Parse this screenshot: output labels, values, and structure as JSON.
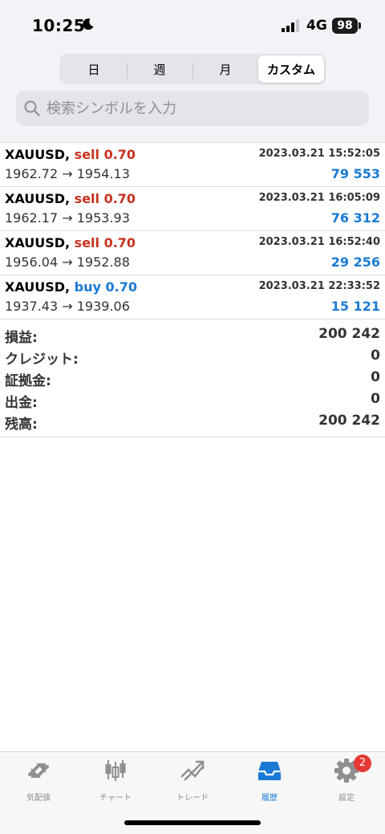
{
  "status_bar": {
    "time": "10:25",
    "network": "4G",
    "battery": "98"
  },
  "segments": [
    {
      "label": "日",
      "active": false
    },
    {
      "label": "週",
      "active": false
    },
    {
      "label": "月",
      "active": false
    },
    {
      "label": "カスタム",
      "active": true
    }
  ],
  "search": {
    "placeholder": "検索シンボルを入力"
  },
  "deals": [
    {
      "symbol": "XAUUSD,",
      "side": "sell 0.70",
      "direction": "sell",
      "time": "2023.03.21 15:52:05",
      "prices": "1962.72 → 1954.13",
      "profit": "79 553"
    },
    {
      "symbol": "XAUUSD,",
      "side": "sell 0.70",
      "direction": "sell",
      "time": "2023.03.21 16:05:09",
      "prices": "1962.17 → 1953.93",
      "profit": "76 312"
    },
    {
      "symbol": "XAUUSD,",
      "side": "sell 0.70",
      "direction": "sell",
      "time": "2023.03.21 16:52:40",
      "prices": "1956.04 → 1952.88",
      "profit": "29 256"
    },
    {
      "symbol": "XAUUSD,",
      "side": "buy 0.70",
      "direction": "buy",
      "time": "2023.03.21 22:33:52",
      "prices": "1937.43 → 1939.06",
      "profit": "15 121"
    }
  ],
  "summary": [
    {
      "label": "損益:",
      "value": "200 242"
    },
    {
      "label": "クレジット:",
      "value": "0"
    },
    {
      "label": "証拠金:",
      "value": "0"
    },
    {
      "label": "出金:",
      "value": "0"
    },
    {
      "label": "残高:",
      "value": "200 242"
    }
  ],
  "tabbar": {
    "items": [
      {
        "label": "気配値",
        "icon": "quotes-icon",
        "active": false
      },
      {
        "label": "チャート",
        "icon": "chart-icon",
        "active": false
      },
      {
        "label": "トレード",
        "icon": "trade-icon",
        "active": false
      },
      {
        "label": "履歴",
        "icon": "history-icon",
        "active": true
      },
      {
        "label": "設定",
        "icon": "settings-icon",
        "active": false
      }
    ],
    "settings_badge": "2"
  },
  "colors": {
    "sell": "#c8321e",
    "buy": "#1a7ad4",
    "profit": "#1a7ad4",
    "active_tab": "#1a7ad4",
    "inactive_tab": "#8e8e93",
    "badge": "#e53935"
  }
}
